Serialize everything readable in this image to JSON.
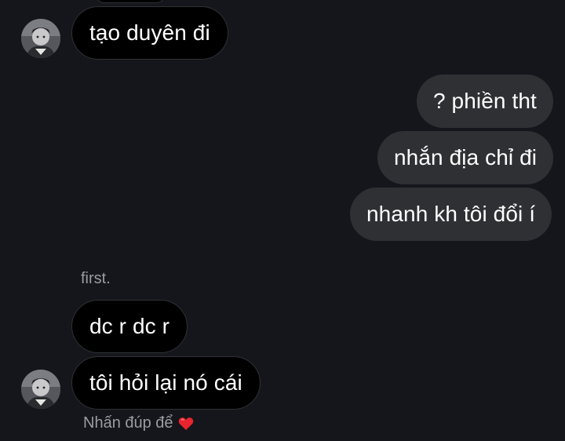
{
  "messages": [
    {
      "text": "tạo duyên đi",
      "direction": "incoming",
      "avatar": true
    },
    {
      "text": "? phiền tht",
      "direction": "outgoing"
    },
    {
      "text": "nhắn địa chỉ đi",
      "direction": "outgoing"
    },
    {
      "text": "nhanh kh tôi đổi í",
      "direction": "outgoing"
    },
    {
      "text": "dc r dc r",
      "direction": "incoming",
      "avatar": false
    },
    {
      "text": "tôi hỏi lại nó cái",
      "direction": "incoming",
      "avatar": true
    }
  ],
  "sender_name": "first.",
  "reaction_hint": "Nhấn đúp để",
  "icons": {
    "avatar": "user-avatar-photo",
    "reaction": "heart-icon"
  },
  "colors": {
    "background": "#15161b",
    "incoming_bubble": "#000000",
    "outgoing_bubble": "#2f3034",
    "heart": "#e8242f"
  }
}
